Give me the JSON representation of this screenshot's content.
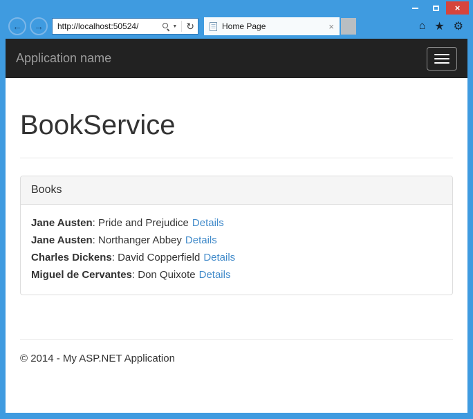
{
  "window": {
    "close_glyph": "×"
  },
  "chrome": {
    "back_icon": "←",
    "forward_icon": "→",
    "address": {
      "url": "http://localhost:50524/",
      "dropdown_icon": "▼",
      "refresh_icon": "↻"
    },
    "tab": {
      "title": "Home Page",
      "close_icon": "×"
    },
    "toolbar": {
      "home_icon": "⌂",
      "favorites_icon": "★",
      "settings_icon": "⚙"
    }
  },
  "page": {
    "navbar": {
      "brand": "Application name"
    },
    "heading": "BookService",
    "panel": {
      "header": "Books",
      "separator": ": ",
      "books": [
        {
          "author": "Jane Austen",
          "title": "Pride and Prejudice",
          "link": "Details"
        },
        {
          "author": "Jane Austen",
          "title": "Northanger Abbey",
          "link": "Details"
        },
        {
          "author": "Charles Dickens",
          "title": "David Copperfield",
          "link": "Details"
        },
        {
          "author": "Miguel de Cervantes",
          "title": "Don Quixote",
          "link": "Details"
        }
      ]
    },
    "footer": "© 2014 - My ASP.NET Application"
  },
  "colors": {
    "frame_blue": "#3f9be0",
    "close_red": "#d6443c",
    "navbar_bg": "#222222",
    "brand_text": "#9d9d9d",
    "link": "#428bca"
  }
}
